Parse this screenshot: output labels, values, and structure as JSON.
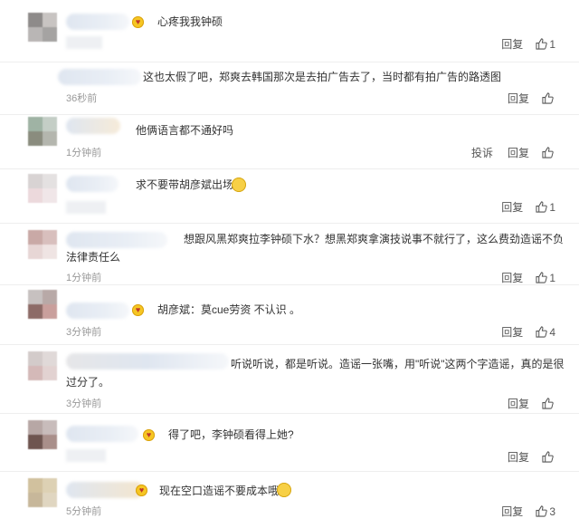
{
  "comments": [
    {
      "text": "心疼我我钟硕",
      "time": "",
      "reply": "回复",
      "report": "",
      "likes": "1"
    },
    {
      "text": "这也太假了吧，郑爽去韩国那次是去拍广告去了，当时都有拍广告的路透图",
      "time": "36秒前",
      "reply": "回复",
      "report": "",
      "likes": ""
    },
    {
      "text": "他俩语言都不通好吗",
      "time": "1分钟前",
      "reply": "回复",
      "report": "投诉",
      "likes": ""
    },
    {
      "text": "求不要带胡彦斌出场",
      "time": "",
      "reply": "回复",
      "report": "",
      "likes": "1"
    },
    {
      "text": "想跟风黑郑爽拉李钟硕下水？想黑郑爽拿演技说事不就行了，这么费劲造谣不负法律责任么",
      "time": "1分钟前",
      "reply": "回复",
      "report": "",
      "likes": "1"
    },
    {
      "text": "胡彦斌：莫cue劳资 不认识 。",
      "time": "3分钟前",
      "reply": "回复",
      "report": "",
      "likes": "4"
    },
    {
      "text": "听说听说，都是听说。造谣一张嘴，用\"听说\"这两个字造谣，真的是很过分了。",
      "time": "3分钟前",
      "reply": "回复",
      "report": "",
      "likes": ""
    },
    {
      "text": "得了吧，李钟硕看得上她?",
      "time": "3分钟前",
      "reply": "回复",
      "report": "",
      "likes": ""
    },
    {
      "text": "现在空口造谣不要成本哦",
      "time": "5分钟前",
      "reply": "回复",
      "report": "",
      "likes": "3"
    }
  ]
}
